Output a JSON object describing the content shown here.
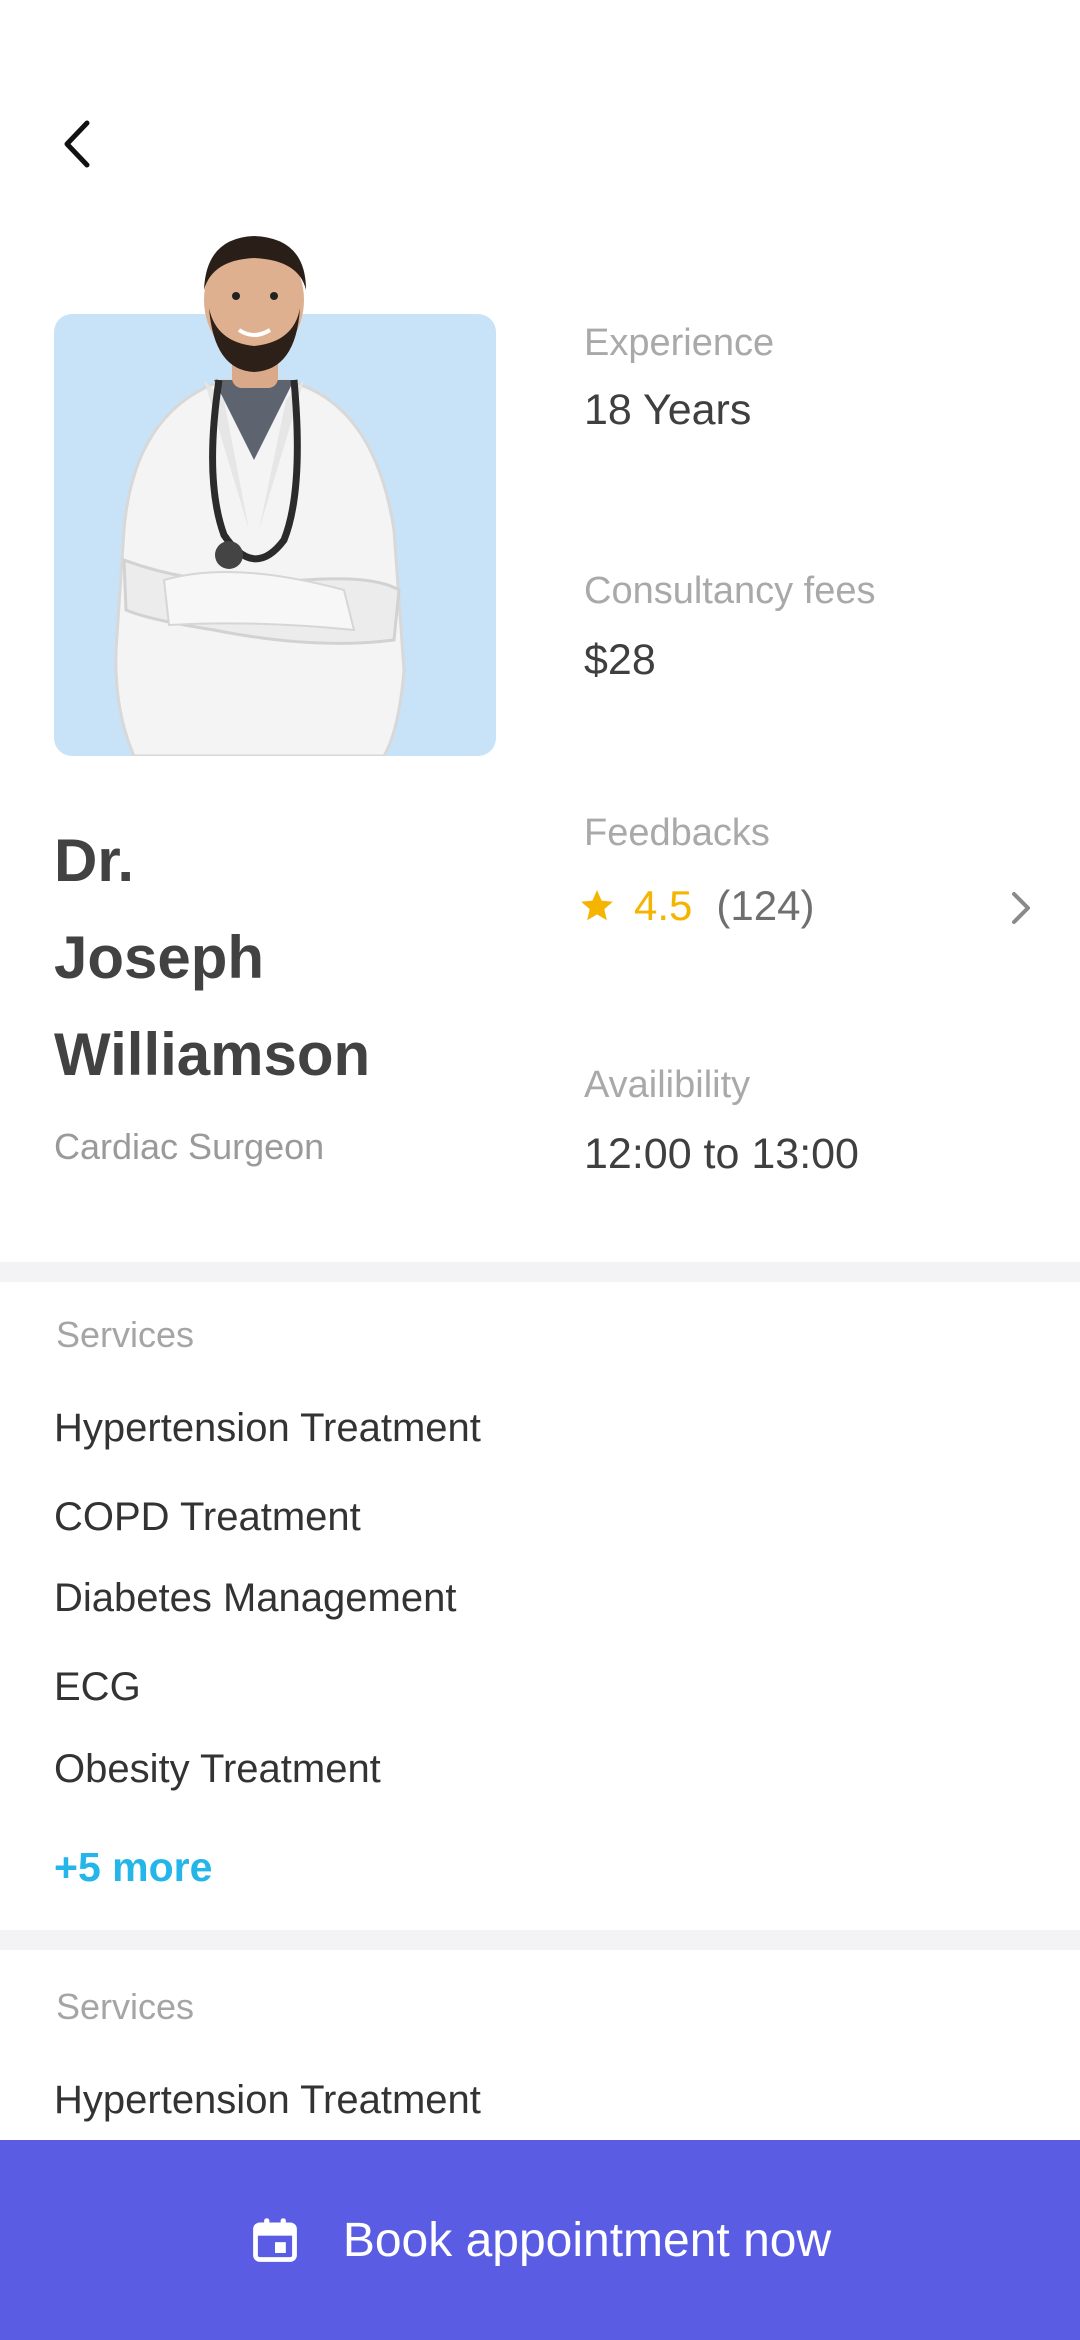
{
  "header": {
    "back_icon": "chevron-left-icon"
  },
  "doctor": {
    "name_line1": "Dr.",
    "name_line2": "Joseph",
    "name_line3": "Williamson",
    "specialty": "Cardiac Surgeon",
    "photo_bg_color": "#c8e3f7"
  },
  "stats": {
    "experience_label": "Experience",
    "experience_value": "18 Years",
    "fees_label": "Consultancy fees",
    "fees_value": "$28",
    "feedback_label": "Feedbacks",
    "rating": "4.5",
    "review_count": "(124)",
    "availability_label": "Availibility",
    "availability_value": "12:00 to 13:00"
  },
  "services": {
    "title": "Services",
    "items": [
      "Hypertension Treatment",
      "COPD Treatment",
      "Diabetes Management",
      "ECG",
      "Obesity Treatment"
    ],
    "more_label": "+5 more"
  },
  "services_2": {
    "title": "Services",
    "items": [
      "Hypertension Treatment"
    ]
  },
  "cta": {
    "label": "Book appointment now",
    "icon": "calendar-icon",
    "color": "#5a5de3"
  },
  "colors": {
    "accent_link": "#25b6e9",
    "rating_star": "#f5b400"
  }
}
